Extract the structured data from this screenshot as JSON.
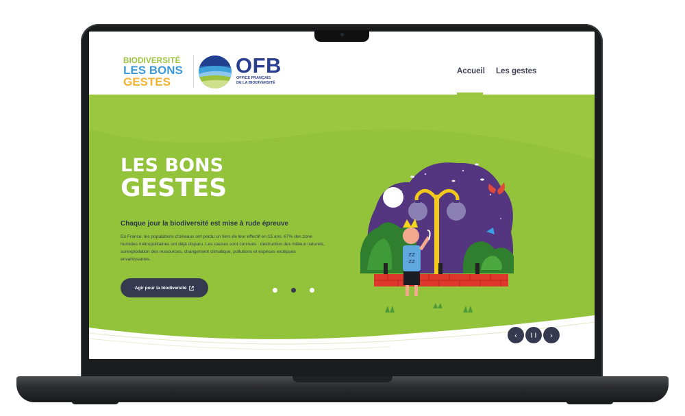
{
  "logo": {
    "line1": "BIODIVERSITÉ",
    "line2": "LES BONS",
    "line3": "GESTES"
  },
  "ofb": {
    "name": "OFB",
    "subtitle_line1": "OFFICE FRANÇAIS",
    "subtitle_line2": "DE LA BIODIVERSITÉ"
  },
  "nav": {
    "items": [
      {
        "label": "Accueil",
        "active": true
      },
      {
        "label": "Les gestes",
        "active": false
      }
    ]
  },
  "hero": {
    "title_line1": "LES BONS",
    "title_line2": "GESTES",
    "subtitle": "Chaque jour la biodiversité est mise à rude épreuve",
    "body": "En France, les populations d'oiseaux ont perdu un tiers de leur effectif en 15 ans. 67% des zone humides métropolitaines ont déjà disparu. Les causes sont connues : destruction des milieux naturels, surexploitation des ressources, changement climatique, pollutions et espèces exotiques envahissantes.",
    "cta_label": "Agir pour la biodiversité",
    "cta_icon": "external-link-icon",
    "carousel": {
      "slide_count": 3,
      "active_index": 1,
      "prev_icon": "chevron-left-icon",
      "pause_icon": "pause-icon",
      "next_icon": "chevron-right-icon",
      "prev_glyph": "‹",
      "pause_glyph": "❙❙",
      "next_glyph": "›"
    }
  },
  "colors": {
    "hero_green": "#93c23b",
    "navy": "#353a51",
    "ofb_blue": "#2a3f8f",
    "accent_green": "#9bc23c",
    "accent_blue": "#3a9ad8",
    "accent_yellow": "#f2b333"
  }
}
